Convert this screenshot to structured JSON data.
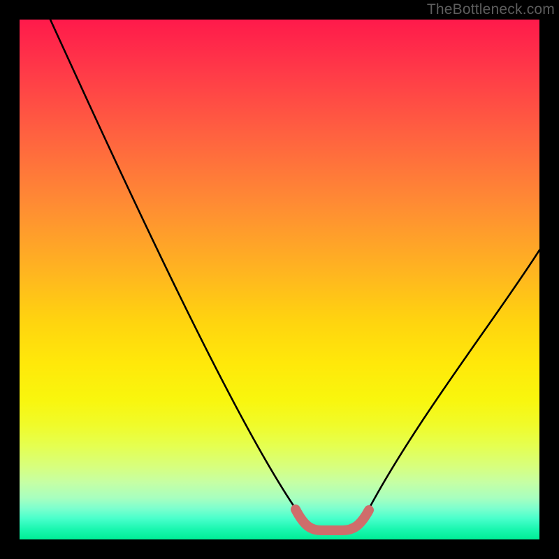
{
  "attribution": "TheBottleneck.com",
  "colors": {
    "curve_stroke": "#000000",
    "trough_stroke": "#cf6d6b",
    "frame": "#000000"
  },
  "chart_data": {
    "type": "line",
    "title": "",
    "xlabel": "",
    "ylabel": "",
    "xlim": [
      0,
      100
    ],
    "ylim": [
      0,
      100
    ],
    "series": [
      {
        "name": "curve",
        "x": [
          6,
          10,
          15,
          20,
          25,
          30,
          35,
          40,
          45,
          50,
          53,
          57,
          63,
          66,
          70,
          75,
          80,
          85,
          90,
          95,
          100
        ],
        "y": [
          100,
          92,
          82,
          72,
          63,
          53,
          44,
          34,
          24,
          13,
          6,
          2,
          2,
          6,
          13,
          22,
          31,
          40,
          48,
          55,
          61
        ]
      }
    ],
    "annotations": {
      "trough": {
        "x_start": 53,
        "x_end": 66,
        "y": 2
      }
    }
  }
}
